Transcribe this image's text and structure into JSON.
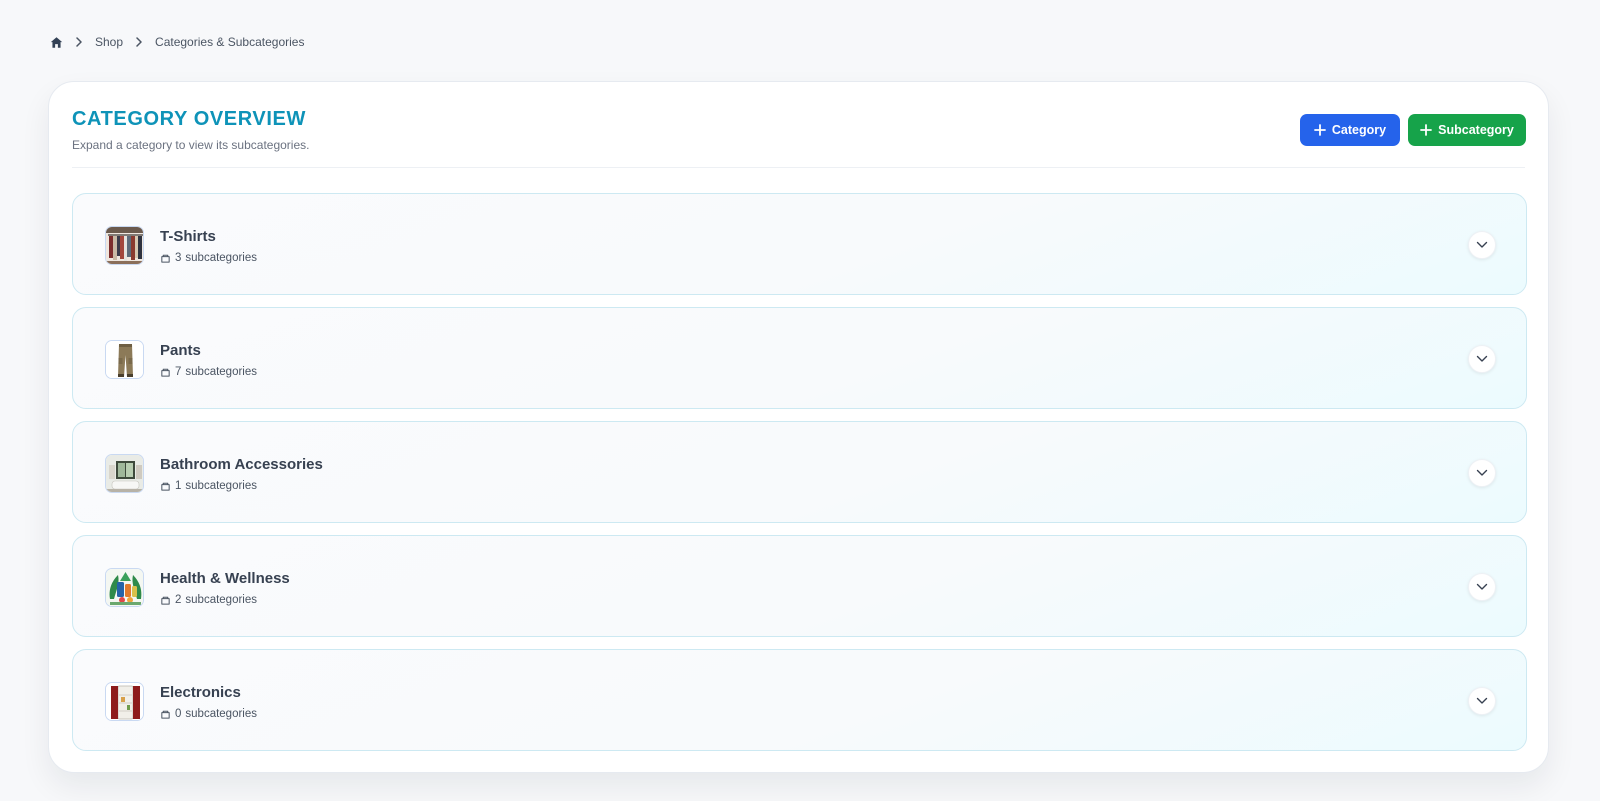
{
  "breadcrumb": {
    "home_icon": "home-icon",
    "items": [
      "Shop",
      "Categories & Subcategories"
    ]
  },
  "header": {
    "title": "CATEGORY OVERVIEW",
    "subtitle": "Expand a category to view its subcategories."
  },
  "actions": {
    "add_category_label": "Category",
    "add_subcategory_label": "Subcategory"
  },
  "categories": [
    {
      "name": "T-Shirts",
      "count": "3",
      "suffix": "subcategories",
      "thumbnail": "clothing-rack"
    },
    {
      "name": "Pants",
      "count": "7",
      "suffix": "subcategories",
      "thumbnail": "cargo-pants"
    },
    {
      "name": "Bathroom Accessories",
      "count": "1",
      "suffix": "subcategories",
      "thumbnail": "bathroom"
    },
    {
      "name": "Health & Wellness",
      "count": "2",
      "suffix": "subcategories",
      "thumbnail": "health-products"
    },
    {
      "name": "Electronics",
      "count": "0",
      "suffix": "subcategories",
      "thumbnail": "refrigerator"
    }
  ],
  "colors": {
    "title": "#0e93b8",
    "primary_button": "#2563eb",
    "success_button": "#16a34a"
  }
}
